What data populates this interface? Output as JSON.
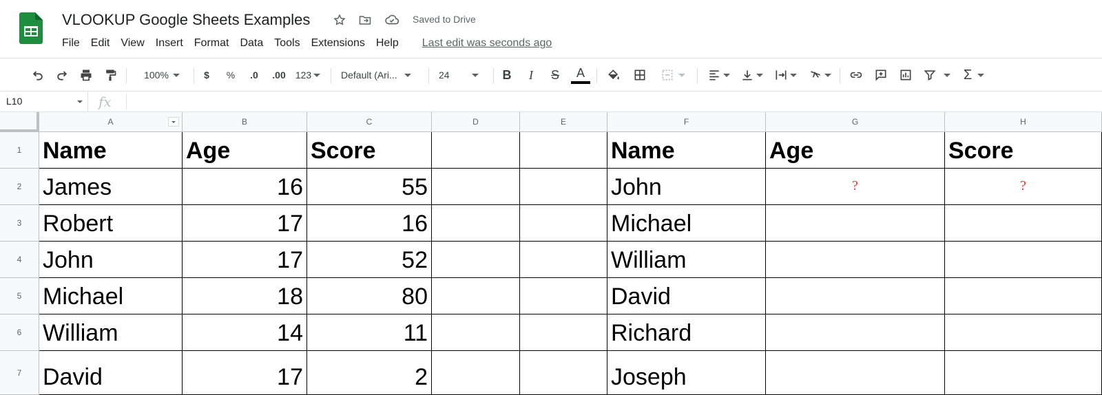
{
  "app": {
    "doc_title": "VLOOKUP Google Sheets Examples",
    "save_status": "Saved to Drive",
    "last_edit": "Last edit was seconds ago",
    "brand_color": "#1e8e3e"
  },
  "menu": [
    "File",
    "Edit",
    "View",
    "Insert",
    "Format",
    "Data",
    "Tools",
    "Extensions",
    "Help"
  ],
  "toolbar": {
    "zoom": "100%",
    "currency": "$",
    "percent": "%",
    "decrease_decimal": ".0",
    "increase_decimal": ".00",
    "more_formats": "123",
    "font_family": "Default (Ari...",
    "font_size": "24",
    "icons": [
      "undo-icon",
      "redo-icon",
      "print-icon",
      "paint-format-icon",
      "bold-icon",
      "italic-icon",
      "strikethrough-icon",
      "text-color-icon",
      "fill-color-icon",
      "borders-icon",
      "merge-cells-icon",
      "horizontal-align-icon",
      "vertical-align-icon",
      "text-wrapping-icon",
      "text-rotation-icon",
      "insert-link-icon",
      "insert-comment-icon",
      "insert-chart-icon",
      "filter-icon",
      "functions-icon"
    ]
  },
  "formula_bar": {
    "name_box": "L10",
    "fx_label": "fx",
    "formula": ""
  },
  "grid": {
    "columns": [
      "A",
      "B",
      "C",
      "D",
      "E",
      "F",
      "G",
      "H"
    ],
    "rows": [
      "1",
      "2",
      "3",
      "4",
      "5",
      "6",
      "7"
    ],
    "cells": {
      "A1": "Name",
      "B1": "Age",
      "C1": "Score",
      "F1": "Name",
      "G1": "Age",
      "H1": "Score",
      "A2": "James",
      "B2": "16",
      "C2": "55",
      "F2": "John",
      "G2": "?",
      "H2": "?",
      "A3": "Robert",
      "B3": "17",
      "C3": "16",
      "F3": "Michael",
      "A4": "John",
      "B4": "17",
      "C4": "52",
      "F4": "William",
      "A5": "Michael",
      "B5": "18",
      "C5": "80",
      "F5": "David",
      "A6": "William",
      "B6": "14",
      "C6": "11",
      "F6": "Richard",
      "A7": "David",
      "B7": "17",
      "C7": "2",
      "F7": "Joseph"
    }
  }
}
